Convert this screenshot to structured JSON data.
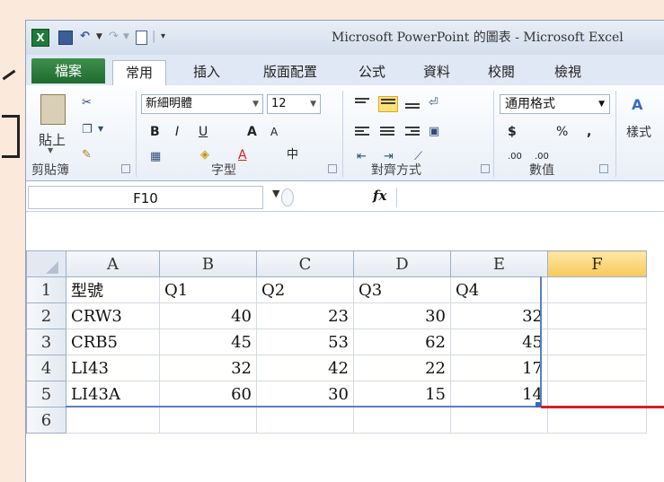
{
  "window": {
    "title": "Microsoft PowerPoint 的圖表  - Microsoft Excel"
  },
  "quick_access": {
    "app_icon": "X",
    "icons": [
      "excel-logo-icon",
      "save-icon",
      "undo-icon",
      "redo-icon",
      "new-icon",
      "customize-icon"
    ]
  },
  "tabs": [
    {
      "label": "檔案"
    },
    {
      "label": "常用"
    },
    {
      "label": "插入"
    },
    {
      "label": "版面配置"
    },
    {
      "label": "公式"
    },
    {
      "label": "資料"
    },
    {
      "label": "校閱"
    },
    {
      "label": "檢視"
    }
  ],
  "ribbon": {
    "clipboard": {
      "paste": "貼上",
      "group": "剪貼簿"
    },
    "font": {
      "name": "新細明體",
      "size": "12",
      "bold": "B",
      "italic": "I",
      "underline": "U",
      "grow": "A",
      "shrink": "A",
      "color_a": "A",
      "phonetic": "中",
      "group": "字型"
    },
    "alignment": {
      "group": "對齊方式"
    },
    "number": {
      "format": "通用格式",
      "currency": "$",
      "percent": "%",
      "comma": ",",
      "inc": ".00",
      "dec": ".00",
      "group": "數值"
    },
    "styles": {
      "label": "樣式"
    }
  },
  "formula_bar": {
    "name_box": "F10",
    "fx": "fx",
    "value": ""
  },
  "sheet": {
    "columns": [
      "A",
      "B",
      "C",
      "D",
      "E",
      "F"
    ],
    "rows": [
      {
        "n": "1",
        "cells": [
          "型號",
          "Q1",
          "Q2",
          "Q3",
          "Q4",
          ""
        ]
      },
      {
        "n": "2",
        "cells": [
          "CRW3",
          "40",
          "23",
          "30",
          "32",
          ""
        ]
      },
      {
        "n": "3",
        "cells": [
          "CRB5",
          "45",
          "53",
          "62",
          "45",
          ""
        ]
      },
      {
        "n": "4",
        "cells": [
          "LI43",
          "32",
          "42",
          "22",
          "17",
          ""
        ]
      },
      {
        "n": "5",
        "cells": [
          "LI43A",
          "60",
          "30",
          "15",
          "14",
          ""
        ]
      },
      {
        "n": "6",
        "cells": [
          "",
          "",
          "",
          "",
          "",
          ""
        ]
      }
    ],
    "selected_column": "F",
    "range_color": "#5b7fc0",
    "highlight_color": "#d42020"
  }
}
